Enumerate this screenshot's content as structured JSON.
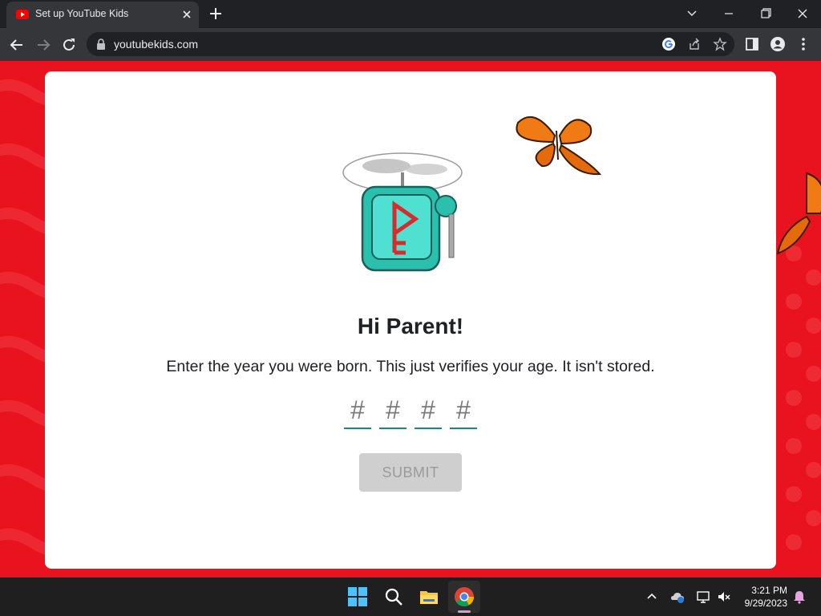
{
  "browser": {
    "tab_title": "Set up YouTube Kids",
    "url": "youtubekids.com"
  },
  "page": {
    "heading": "Hi Parent!",
    "subtext": "Enter the year you were born. This just verifies your age. It isn't stored.",
    "digit_placeholder": "#",
    "submit_label": "SUBMIT"
  },
  "taskbar": {
    "time": "3:21 PM",
    "date": "9/29/2023"
  },
  "colors": {
    "brand_red": "#e8131e",
    "input_underline": "#0f8b8d"
  }
}
